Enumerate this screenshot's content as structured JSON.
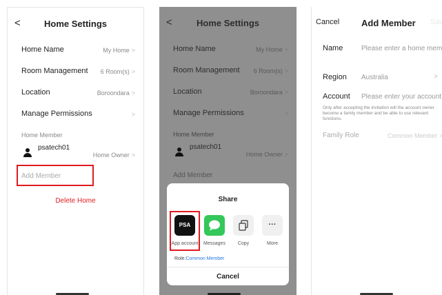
{
  "screen1": {
    "title": "Home Settings",
    "back": "<",
    "rows": [
      {
        "label": "Home Name",
        "value": "My Home"
      },
      {
        "label": "Room Management",
        "value": "6 Room(s)"
      },
      {
        "label": "Location",
        "value": "Boroondara"
      },
      {
        "label": "Manage Permissions",
        "value": ""
      }
    ],
    "home_member_header": "Home Member",
    "member": {
      "name": "psatech01",
      "role": "Home Owner"
    },
    "add_member": "Add Member",
    "delete_home": "Delete Home",
    "chevron": ">"
  },
  "screen2": {
    "title": "Home Settings",
    "back": "<",
    "rows": [
      {
        "label": "Home Name",
        "value": "My Home"
      },
      {
        "label": "Room Management",
        "value": "6 Room(s)"
      },
      {
        "label": "Location",
        "value": "Boroondara"
      },
      {
        "label": "Manage Permissions",
        "value": ""
      }
    ],
    "home_member_header": "Home Member",
    "member": {
      "name": "psatech01",
      "role": "Home Owner"
    },
    "add_member": "Add Member",
    "chevron": ">",
    "share": {
      "title": "Share",
      "options": [
        {
          "label": "App account",
          "icon_text": "PSA"
        },
        {
          "label": "Messages"
        },
        {
          "label": "Copy"
        },
        {
          "label": "More",
          "icon_text": "···"
        }
      ],
      "role_prefix": "Role:",
      "role_value": "Common Member",
      "cancel": "Cancel"
    }
  },
  "screen3": {
    "cancel": "Cancel",
    "title": "Add Member",
    "save": "Save",
    "name_label": "Name",
    "name_placeholder": "Please enter a home member n",
    "region_label": "Region",
    "region_value": "Australia",
    "account_label": "Account",
    "account_placeholder": "Please enter your account",
    "note": "Only after accepting the invitation will the account owner become a family member and be able to use relevant functions.",
    "family_role_label": "Family Role",
    "family_role_value": "Common Member",
    "chevron": ">"
  },
  "colors": {
    "accent_red": "#e0191f",
    "link_blue": "#2a7ae2",
    "messages_green": "#34c759"
  }
}
